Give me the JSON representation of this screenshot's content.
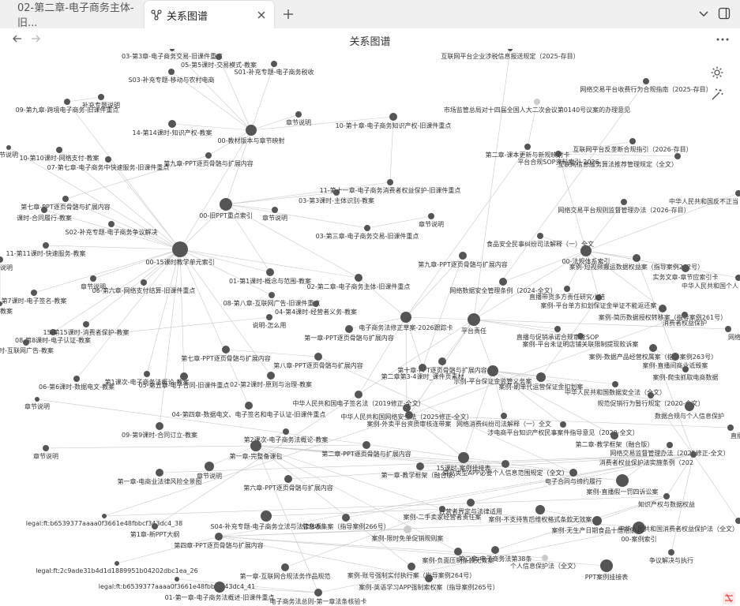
{
  "tabs": [
    {
      "label": "02-第二章-电子商务主体-旧...",
      "active": false
    },
    {
      "label": "关系图谱",
      "active": true
    }
  ],
  "page_title": "关系图谱",
  "icons": {
    "back": "arrow-left-icon",
    "forward": "arrow-right-icon",
    "more": "more-horizontal-icon",
    "settings": "gear-icon",
    "magic": "wand-icon",
    "graph_tab": "graph-icon",
    "new_tab": "plus-icon",
    "dropdown": "chevron-down-icon",
    "sidebar": "sidebar-toggle-icon",
    "corner": "broken-image-icon"
  },
  "colors": {
    "node": "#555555",
    "edge": "#c8c8c8",
    "muted_node": "#cccccc",
    "corner_icon": "#e05050"
  },
  "graph": {
    "nodes": [
      {
        "label": "03-第3章-电子商务交易-旧课件重点"
      },
      {
        "label": "互联网平台企业涉税信息报送规定（2025-存目）"
      },
      {
        "label": "05-第5课时-交易模式-教案"
      },
      {
        "label": "S01-补充专题-电子商务税收"
      },
      {
        "label": "S03-补充专题-移动与农村电商"
      },
      {
        "label": "网络交易平台收费行为合规指南（2025-存目）"
      },
      {
        "label": "补充专题说明"
      },
      {
        "label": "09-第九章-跨境电子商务-旧课件重点"
      },
      {
        "label": "市场监管总局对十四届全国人大二次会议第0140号议案的办理意见"
      },
      {
        "label": "章节说明"
      },
      {
        "label": "10-第十章-电子商务知识产权-旧课件重点"
      },
      {
        "label": "14-第14课时-知识产权-教案"
      },
      {
        "label": "00-教材版本与章节映射"
      },
      {
        "label": "节说明"
      },
      {
        "label": "10-第10课时-网络支付-教案"
      },
      {
        "label": "互联网平台反垄断合规指引（2026-存目）"
      },
      {
        "label": "第二章-课本更新与新规映射卡"
      },
      {
        "label": "07-第七章-电子商务中快速服务-旧课件重点"
      },
      {
        "label": "平台合规SOP资料索引-2026"
      },
      {
        "label": "第九章-PPT逐页骨骼与扩展内容"
      },
      {
        "label": "互联网信息服务算法推荐管理规定（全文）"
      },
      {
        "label": "11-第十一章-电子商务消费者权益保护-旧课件重点"
      },
      {
        "label": "03-第3课时-主体识别-教案"
      },
      {
        "label": "中华人民共和国反不正当"
      },
      {
        "label": "第七章-PPT逐页骨骼与扩展内容"
      },
      {
        "label": "00-旧PPT重点索引"
      },
      {
        "label": "网络交易平台规则监督管理办法（2026-存目）"
      },
      {
        "label": "课时-合同履行-教案"
      },
      {
        "label": "章节说明"
      },
      {
        "label": "章节说明"
      },
      {
        "label": "S02-补充专题-电子商务争议解决"
      },
      {
        "label": "03-第三章-电子商务交易-旧课件重点"
      },
      {
        "label": "食品安全民事纠纷司法解释（一）全文"
      },
      {
        "label": "11-第11课时-快速服务-教案"
      },
      {
        "label": "00-15课时教学单元索引"
      },
      {
        "label": "00-法规体系索引"
      },
      {
        "label": "第九章-PPT逐页骨骼与扩展内容"
      },
      {
        "label": "案例-短视频搬运数据权益案（指导案例262号）"
      },
      {
        "label": "说明"
      },
      {
        "label": "实务文章-章节应索引卡"
      },
      {
        "label": "01-第1课时-概念与范围-教案"
      },
      {
        "label": "中华人民共和国个人"
      },
      {
        "label": "章节说明"
      },
      {
        "label": "02-第二章-电子商务主体-旧课件重点"
      },
      {
        "label": "网络数据安全管理条例（2024-全文）"
      },
      {
        "label": "直播带货多方责任研究小结"
      },
      {
        "label": "06-第六章-网络支付结算-旧课件重点"
      },
      {
        "label": "第7课时-电子签名-教案"
      },
      {
        "label": "教案"
      },
      {
        "label": "08-第八章-互联网广告-旧课件重点"
      },
      {
        "label": "案例-平台单方扣划保证金举证不能返还案"
      },
      {
        "label": "04-第4课时-经营者义务-教案"
      },
      {
        "label": "案例-简历数据授权转移案（指导案例261号）"
      },
      {
        "label": "消费者权益保护"
      },
      {
        "label": "说明-怎么用"
      },
      {
        "label": "电子商务法修正草案-2026跟踪卡"
      },
      {
        "label": "平台责任"
      },
      {
        "label": "第一章-PPT逐页骨骼与扩展内容"
      },
      {
        "label": "08-第8课时-电子认证-教案"
      },
      {
        "label": "15-第15课时-消费者保护-教案"
      },
      {
        "label": "直播与促销承诺合规审查SOP"
      },
      {
        "label": "网络反不正当竞"
      },
      {
        "label": "时-互联网广告-教案"
      },
      {
        "label": "案例-平台未证明店铺关联限制提现败诉案"
      },
      {
        "label": "案例-数据产品经营权属案（指导案例263号）"
      },
      {
        "label": "第七章-PPT逐页骨骼与扩展内容"
      },
      {
        "label": "第八章-PPT逐页骨骼与扩展内容"
      },
      {
        "label": "案例-直播间商业诋毁案"
      },
      {
        "label": "第十章-PPT逐页骨骼与扩展内容"
      },
      {
        "label": "第二章第3-4课时_课件页素材"
      },
      {
        "label": "案例-爬虫抓取电商数据"
      },
      {
        "label": "第1课次-电子商务法概论-教案"
      },
      {
        "label": "05-第五章-电子合同-旧课件重点"
      },
      {
        "label": "02-第2课时-原则与治理-教案"
      },
      {
        "label": "示例-平台保证金监管义务案"
      },
      {
        "label": "06-第6课时-数据电文-教案"
      },
      {
        "label": "案例-刷单代运营保证金扣划案"
      },
      {
        "label": "中华人民共和国数据安全法（全文）"
      },
      {
        "label": "章节说明"
      },
      {
        "label": "中华人民共和国电子签名法（2019修正-全文）"
      },
      {
        "label": "规范促销行为暂行规定（2020-全文）"
      },
      {
        "label": "04-第四章-数据电文、电子签名和电子认证-旧课件重点"
      },
      {
        "label": "中华人民共和国网络安全法（2025修正-全文）"
      },
      {
        "label": "数据合规与个人信息保护"
      },
      {
        "label": "案例-外卖平台资质审核连带案"
      },
      {
        "label": "网络消费纠纷司法解释（一）全文"
      },
      {
        "label": "09-第9课时-合同订立-教案"
      },
      {
        "label": "涉电商平台知识产权民事案件指导意见（2020-全文）"
      },
      {
        "label": "章节说明"
      },
      {
        "label": "直播营"
      },
      {
        "label": "第2课次-电子商务法概论-教案"
      },
      {
        "label": "第二章-教学框架（融合版）"
      },
      {
        "label": "第一章-完整备课包"
      },
      {
        "label": "第二章-PPT逐页骨骼与扩展内容"
      },
      {
        "label": "网络交易监督管理办法（2025修正-全文）"
      },
      {
        "label": "15课时-案例挂接表"
      },
      {
        "label": "消费者权益保护法实施条例（202"
      },
      {
        "label": "第一章-教学框架（融合版）"
      },
      {
        "label": "常见类型APP必要个人信息范围规定（全文）"
      },
      {
        "label": "第一章-电商业法律风险全景图"
      },
      {
        "label": "章节说明"
      },
      {
        "label": "电子合同与缔约履行"
      },
      {
        "label": "第六章-PPT逐页骨骼与扩展内容"
      },
      {
        "label": "案例-直播假一罚四诉讼案"
      },
      {
        "label": "知识产权与数据权益"
      },
      {
        "label": "经营者界定与法律适用"
      },
      {
        "label": "legal:ft:b6539377aaaa0f3661e48fbbcf343dc4_38"
      },
      {
        "label": "S04-补充专题-电子商务立法与法律体系"
      },
      {
        "label": "案例-二手卖家经营者责任案"
      },
      {
        "label": "案例-不支持售后维权格式条款无效案"
      },
      {
        "label": "信息收集案（指导案例266号）"
      },
      {
        "label": "案例-无生产日期食品十倍赔偿案"
      },
      {
        "label": "第1章-新PPT大纲"
      },
      {
        "label": "案例-限时免单促销规则案"
      },
      {
        "label": "00-案例索引"
      },
      {
        "label": "中华人民共和国消费者权益保护法（全文）"
      },
      {
        "label": "第四章-PPT逐页骨骼与扩展内容"
      },
      {
        "label": "案例-负面压制条款无效案"
      },
      {
        "label": "第二章-电子商务法第38条"
      },
      {
        "label": "个人信息保护法（全文）"
      },
      {
        "label": "争议解决与执行"
      },
      {
        "label": "legal:ft:2c9ade31b4d1d1889951b04202dbc1ea_26"
      },
      {
        "label": "第一章-互联网合规法务作品规范"
      },
      {
        "label": "案例-账号强制实付执行案（指导案例264号）"
      },
      {
        "label": "PPT案例挂接表"
      },
      {
        "label": "legal:ft:b6539377aaaa0f3661e48fbbcf343dc4_41"
      },
      {
        "label": "案例-英语学习APP强制索权案（指导案例265号）"
      },
      {
        "label": "01-第一章-电子商务法概述-旧课件重点"
      },
      {
        "label": "电子商务法总则-第一章法条核验卡"
      }
    ]
  }
}
